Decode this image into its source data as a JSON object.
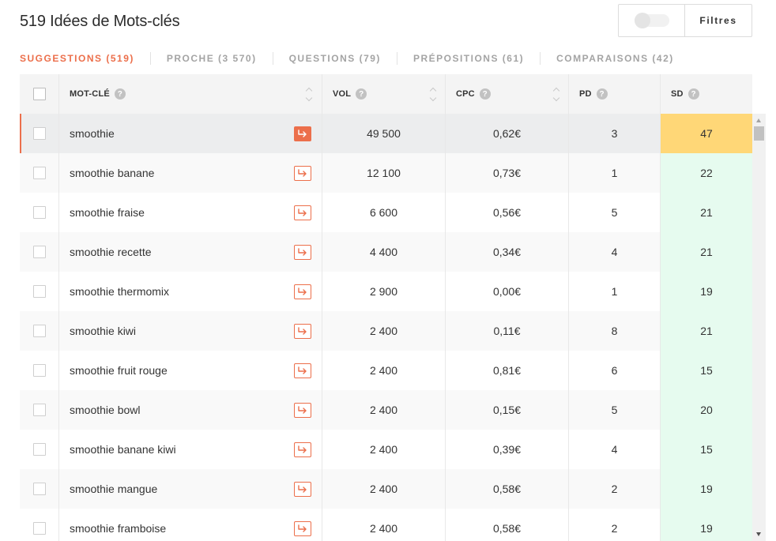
{
  "header": {
    "title": "519 Idées de Mots-clés"
  },
  "filters": {
    "label": "Filtres"
  },
  "tabs": [
    {
      "label": "SUGGESTIONS (519)",
      "active": true
    },
    {
      "label": "PROCHE (3 570)",
      "active": false
    },
    {
      "label": "QUESTIONS (79)",
      "active": false
    },
    {
      "label": "PRÉPOSITIONS (61)",
      "active": false
    },
    {
      "label": "COMPARAISONS (42)",
      "active": false
    }
  ],
  "columns": {
    "keyword": "MOT-CLÉ",
    "vol": "VOL",
    "cpc": "CPC",
    "pd": "PD",
    "sd": "SD",
    "help_symbol": "?"
  },
  "rows": [
    {
      "keyword": "smoothie",
      "vol": "49 500",
      "cpc": "0,62€",
      "pd": "3",
      "sd": "47"
    },
    {
      "keyword": "smoothie banane",
      "vol": "12 100",
      "cpc": "0,73€",
      "pd": "1",
      "sd": "22"
    },
    {
      "keyword": "smoothie fraise",
      "vol": "6 600",
      "cpc": "0,56€",
      "pd": "5",
      "sd": "21"
    },
    {
      "keyword": "smoothie recette",
      "vol": "4 400",
      "cpc": "0,34€",
      "pd": "4",
      "sd": "21"
    },
    {
      "keyword": "smoothie thermomix",
      "vol": "2 900",
      "cpc": "0,00€",
      "pd": "1",
      "sd": "19"
    },
    {
      "keyword": "smoothie kiwi",
      "vol": "2 400",
      "cpc": "0,11€",
      "pd": "8",
      "sd": "21"
    },
    {
      "keyword": "smoothie fruit rouge",
      "vol": "2 400",
      "cpc": "0,81€",
      "pd": "6",
      "sd": "15"
    },
    {
      "keyword": "smoothie bowl",
      "vol": "2 400",
      "cpc": "0,15€",
      "pd": "5",
      "sd": "20"
    },
    {
      "keyword": "smoothie banane kiwi",
      "vol": "2 400",
      "cpc": "0,39€",
      "pd": "4",
      "sd": "15"
    },
    {
      "keyword": "smoothie mangue",
      "vol": "2 400",
      "cpc": "0,58€",
      "pd": "2",
      "sd": "19"
    },
    {
      "keyword": "smoothie framboise",
      "vol": "2 400",
      "cpc": "0,58€",
      "pd": "2",
      "sd": "19"
    }
  ],
  "colors": {
    "accent": "#ec6f4b",
    "sd_high": "#ffd777",
    "sd_low": "#e6fbef"
  },
  "icons": {
    "row_action": "arrow-turn-right-icon",
    "help": "question-circle-icon",
    "sort": "sort-arrows-icon"
  }
}
